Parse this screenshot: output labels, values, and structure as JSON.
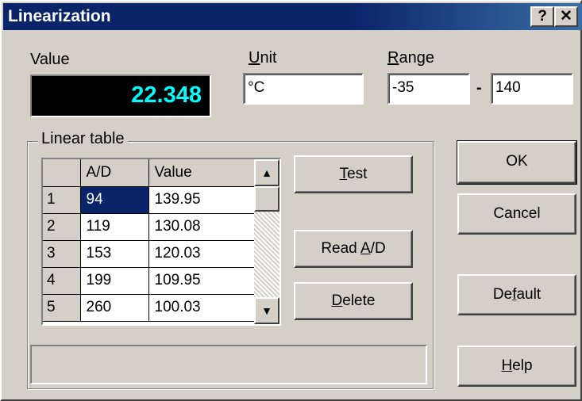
{
  "window": {
    "title": "Linearization",
    "help_glyph": "?",
    "close_glyph": "✕"
  },
  "value": {
    "label": "Value",
    "display": "22.348"
  },
  "unit": {
    "label_u": "U",
    "label_rest": "nit",
    "value": "°C"
  },
  "range": {
    "label_r": "R",
    "label_rest": "ange",
    "min": "-35",
    "separator": "-",
    "max": "140"
  },
  "linear_table": {
    "label": "Linear table",
    "columns": [
      "A/D",
      "Value"
    ],
    "rows": [
      {
        "index": "1",
        "ad": "94",
        "value": "139.95"
      },
      {
        "index": "2",
        "ad": "119",
        "value": "130.08"
      },
      {
        "index": "3",
        "ad": "153",
        "value": "120.03"
      },
      {
        "index": "4",
        "ad": "199",
        "value": "109.95"
      },
      {
        "index": "5",
        "ad": "260",
        "value": "100.03"
      }
    ]
  },
  "buttons": {
    "test": {
      "u": "T",
      "rest": "est"
    },
    "read_ad": {
      "pre": "Read ",
      "u": "A",
      "rest": "/D"
    },
    "delete": {
      "u": "D",
      "rest": "elete"
    },
    "ok": "OK",
    "cancel": "Cancel",
    "default": {
      "pre": "De",
      "u": "f",
      "rest": "ault"
    },
    "help": {
      "u": "H",
      "rest": "elp"
    }
  },
  "icons": {
    "scroll_up": "▲",
    "scroll_down": "▼"
  },
  "colors": {
    "title_bar": "#0a246a",
    "lcd_text": "#00ffff",
    "selection": "#0a246a"
  }
}
